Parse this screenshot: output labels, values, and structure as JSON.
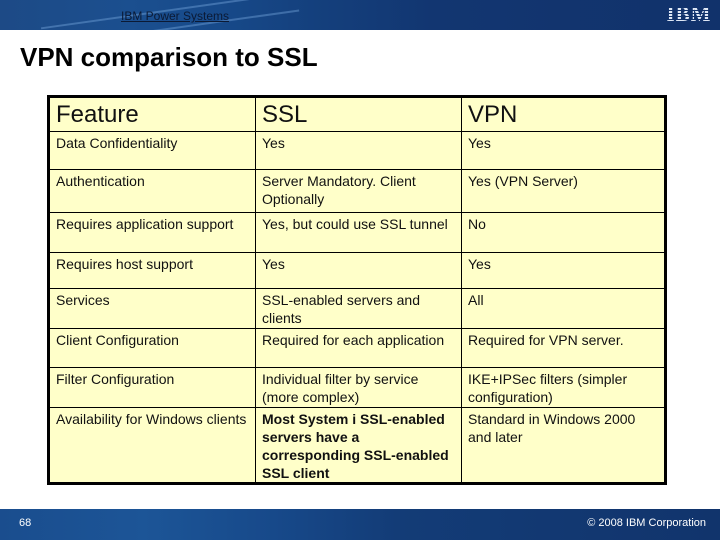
{
  "header": {
    "brand_link": "IBM Power Systems",
    "logo": "IBM"
  },
  "title": "VPN comparison to SSL",
  "table": {
    "columns": [
      "Feature",
      "SSL",
      "VPN"
    ],
    "rows": [
      {
        "feature": "Data Confidentiality",
        "ssl": "Yes",
        "vpn": "Yes"
      },
      {
        "feature": "Authentication",
        "ssl": "Server Mandatory.  Client Optionally",
        "vpn": "Yes (VPN Server)"
      },
      {
        "feature": "Requires application support",
        "ssl": "Yes, but could use SSL tunnel",
        "vpn": "No"
      },
      {
        "feature": "Requires host support",
        "ssl": "Yes",
        "vpn": "Yes"
      },
      {
        "feature": "Services",
        "ssl": "SSL-enabled servers and clients",
        "vpn": "All"
      },
      {
        "feature": "Client Configuration",
        "ssl": "Required for each application",
        "vpn": "Required for VPN server."
      },
      {
        "feature": "Filter Configuration",
        "ssl": "Individual filter by service (more complex)",
        "vpn": "IKE+IPSec filters (simpler configuration)"
      },
      {
        "feature": "Availability for Windows clients",
        "ssl": "Most System i SSL-enabled servers have a corresponding SSL-enabled SSL client",
        "vpn": "Standard in Windows 2000 and later"
      }
    ]
  },
  "footer": {
    "page_number": "68",
    "copyright": "© 2008 IBM Corporation"
  }
}
